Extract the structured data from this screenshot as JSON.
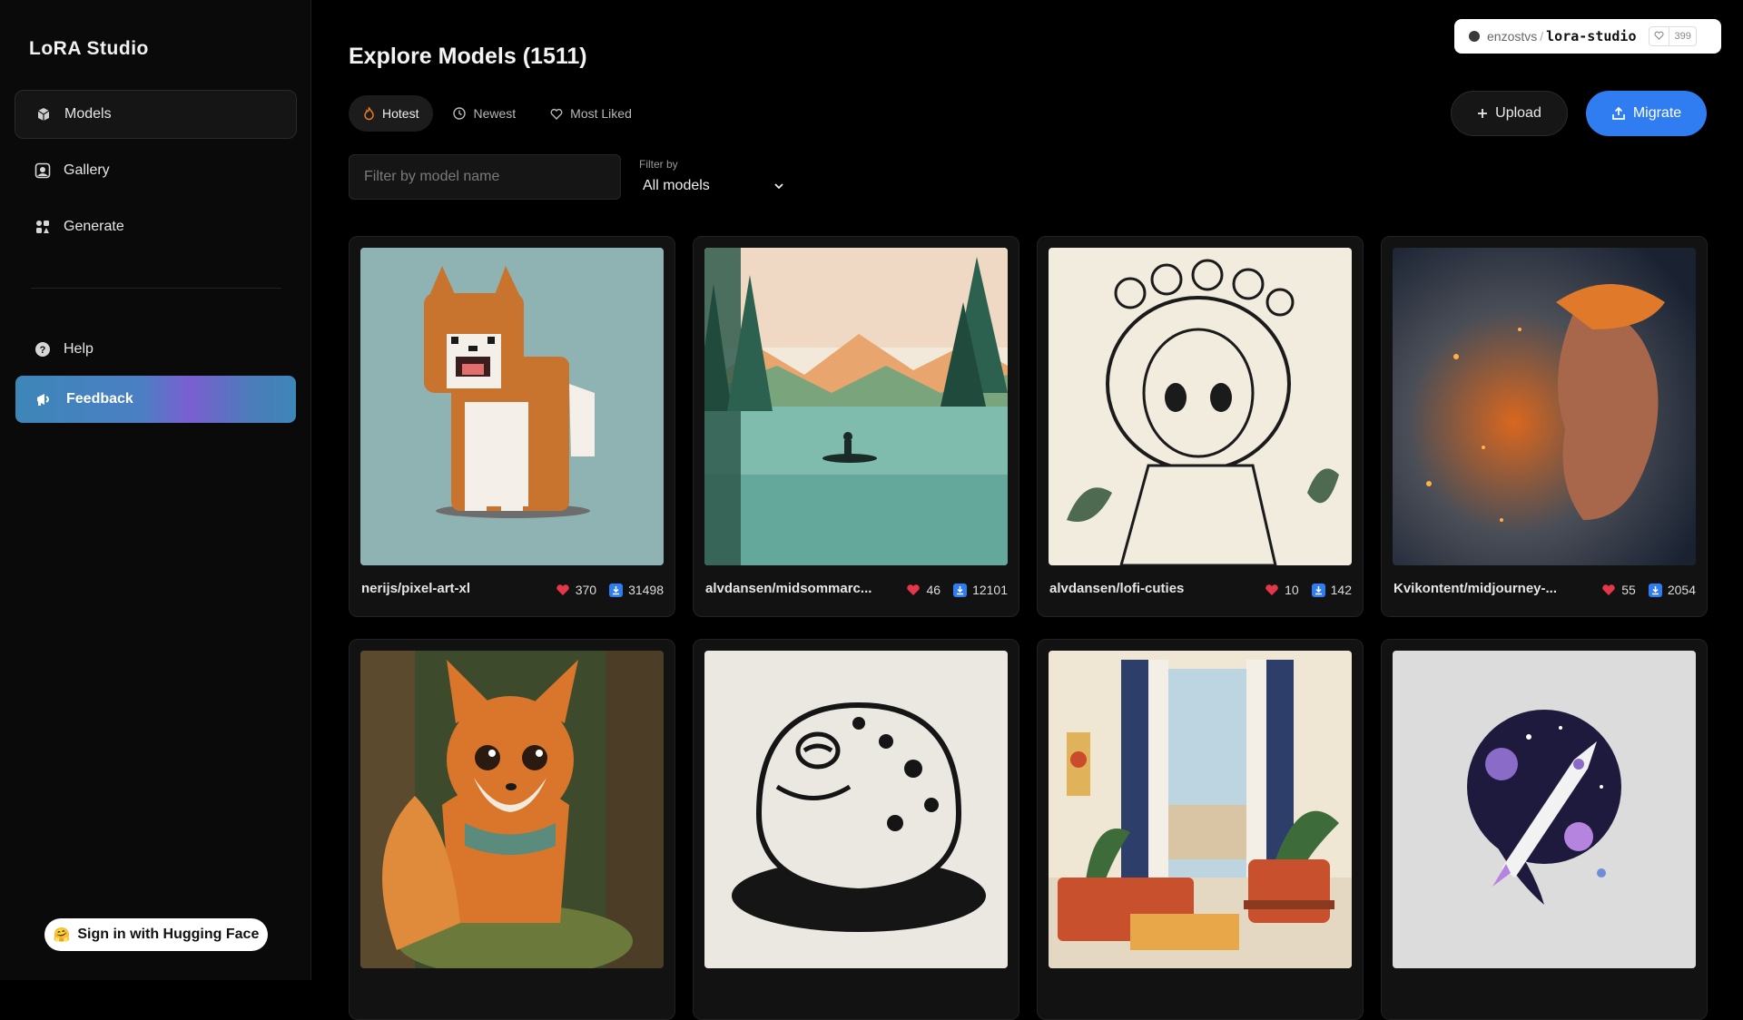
{
  "app": {
    "title": "LoRA Studio"
  },
  "sidebar": {
    "items": [
      {
        "label": "Models",
        "icon": "cube-icon"
      },
      {
        "label": "Gallery",
        "icon": "gallery-icon"
      },
      {
        "label": "Generate",
        "icon": "generate-icon"
      }
    ],
    "help_label": "Help",
    "feedback_label": "Feedback",
    "signin_label": "Sign in with Hugging Face",
    "signin_emoji": "🤗"
  },
  "header": {
    "title": "Explore Models (1511)",
    "tabs": [
      {
        "label": "Hotest",
        "icon": "flame-icon",
        "active": true
      },
      {
        "label": "Newest",
        "icon": "clock-icon",
        "active": false
      },
      {
        "label": "Most Liked",
        "icon": "heart-outline-icon",
        "active": false
      }
    ],
    "upload_label": "Upload",
    "migrate_label": "Migrate"
  },
  "repo_badge": {
    "owner": "enzostvs",
    "slash": "/",
    "repo": "lora-studio",
    "likes": "399"
  },
  "filters": {
    "search_placeholder": "Filter by model name",
    "filter_by_label": "Filter by",
    "filter_value": "All models"
  },
  "models": [
    {
      "name": "nerijs/pixel-art-xl",
      "likes": "370",
      "downloads": "31498"
    },
    {
      "name": "alvdansen/midsommarc...",
      "likes": "46",
      "downloads": "12101"
    },
    {
      "name": "alvdansen/lofi-cuties",
      "likes": "10",
      "downloads": "142"
    },
    {
      "name": "Kvikontent/midjourney-...",
      "likes": "55",
      "downloads": "2054"
    },
    {
      "name": "",
      "likes": "",
      "downloads": ""
    },
    {
      "name": "",
      "likes": "",
      "downloads": ""
    },
    {
      "name": "",
      "likes": "",
      "downloads": ""
    },
    {
      "name": "",
      "likes": "",
      "downloads": ""
    }
  ],
  "colors": {
    "accent": "#2f7df0",
    "heart": "#e5374a",
    "download": "#2f7df0",
    "background": "#000000"
  }
}
